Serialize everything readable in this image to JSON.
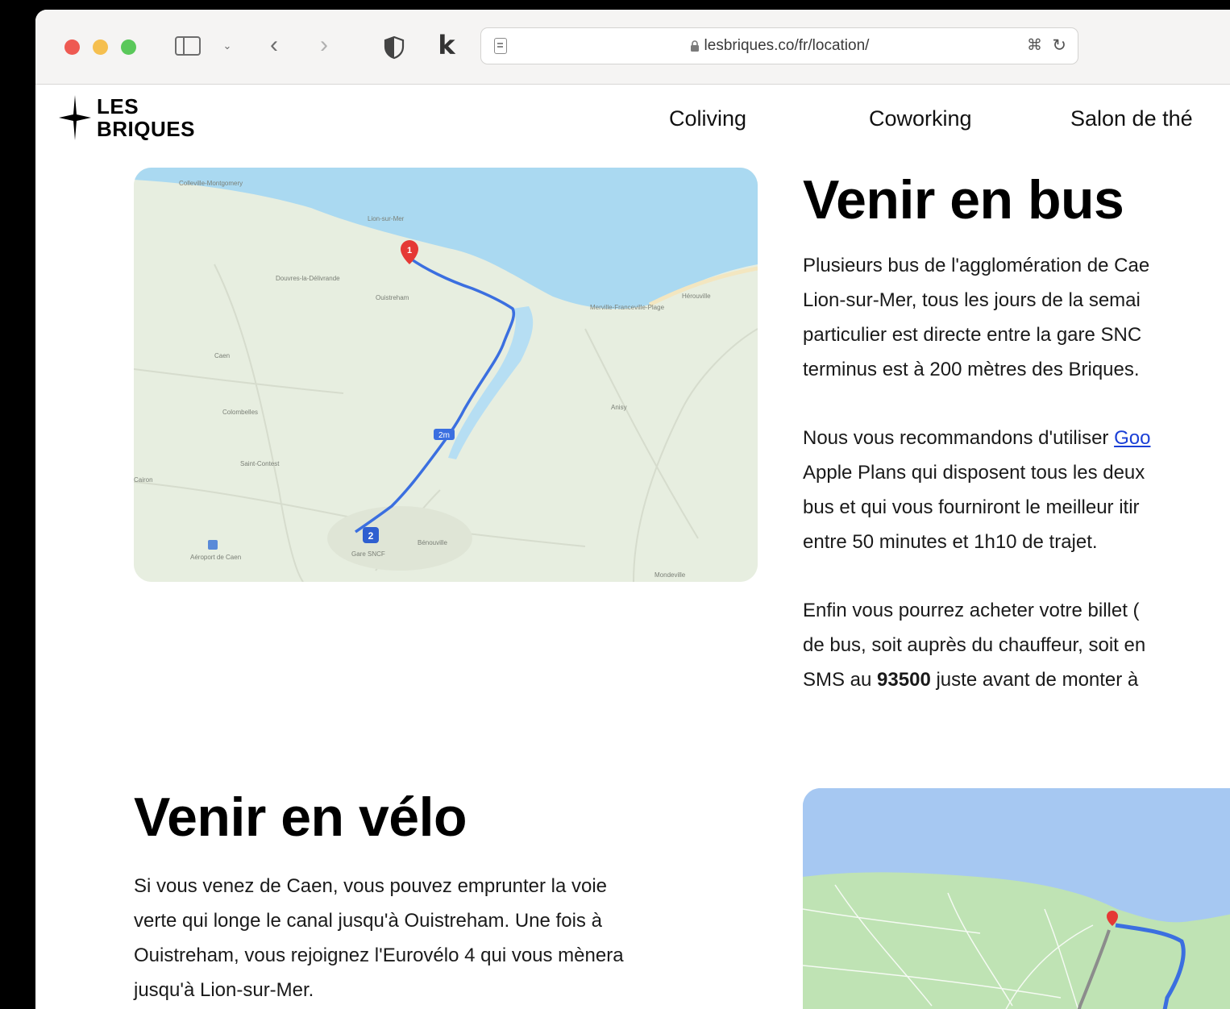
{
  "browser": {
    "url": "lesbriques.co/fr/location/"
  },
  "site": {
    "logo_line1": "LES",
    "logo_line2": "BRIQUES",
    "nav": [
      "Coliving",
      "Coworking",
      "Salon de thé"
    ]
  },
  "bus_section": {
    "title": "Venir en bus",
    "para1": {
      "lines": [
        "Plusieurs bus de l'agglomération de Cae",
        "Lion-sur-Mer, tous les jours de la semai",
        "particulier est directe entre la gare SNC",
        "terminus est à 200 mètres des Briques."
      ]
    },
    "para2": {
      "line1_before_link": "Nous vous recommandons d'utiliser ",
      "link_text": "Goo",
      "lines": [
        "Apple Plans qui disposent tous les deux",
        "bus et qui vous fourniront le meilleur itir",
        "entre 50 minutes et 1h10 de trajet."
      ]
    },
    "para3": {
      "line1": "Enfin vous pourrez acheter votre billet (",
      "line2": "de bus, soit auprès du chauffeur, soit en",
      "line3_before": "SMS au ",
      "sms_number": "93500",
      "line3_after": " juste avant de monter à"
    },
    "map": {
      "marker_start_label": "1",
      "marker_end_label": "2",
      "line_badge": "2m",
      "labels": [
        "Colleville-Montgomery",
        "Lion-sur-Mer",
        "Douvres-la-Délivrande",
        "Ouistreham",
        "Merville-Franceville-Plage",
        "Hérouville",
        "Caen",
        "Colombelles",
        "Saint-Contest",
        "Cairon",
        "Anisy",
        "Bénouville",
        "Mondeville",
        "Aéroport de Caen",
        "Gare SNCF"
      ]
    }
  },
  "velo_section": {
    "title": "Venir en vélo",
    "lines": [
      "Si vous venez de Caen, vous pouvez emprunter la voie",
      "verte qui longe le canal jusqu'à Ouistreham. Une fois à",
      "Ouistreham, vous rejoignez l'Eurovélo 4 qui vous mènera",
      "jusqu'à Lion-sur-Mer."
    ]
  },
  "colors": {
    "route_blue": "#3b6fe0",
    "marker_red": "#e53935",
    "link_blue": "#1a3fd6",
    "sea": "#a9d8f2",
    "land": "#eaf0e3"
  }
}
